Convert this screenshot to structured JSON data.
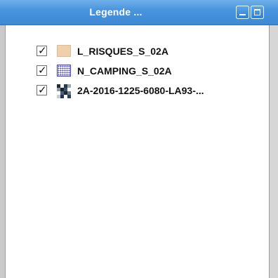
{
  "window": {
    "title": "Legende ..."
  },
  "icons": {
    "minimize": "minimize-icon",
    "maximize": "maximize-icon",
    "check": "checkmark-icon"
  },
  "colors": {
    "titlebar": "#4a94de",
    "risques_fill": "#f0cfac",
    "camping_pattern": "#3a3ad0"
  },
  "layers": [
    {
      "label": "L_RISQUES_S_02A",
      "checked": true,
      "check_glyph": "✓"
    },
    {
      "label": "N_CAMPING_S_02A",
      "checked": true,
      "check_glyph": "✓"
    },
    {
      "label": "2A-2016-1225-6080-LA93-...",
      "checked": true,
      "check_glyph": "✓"
    }
  ]
}
